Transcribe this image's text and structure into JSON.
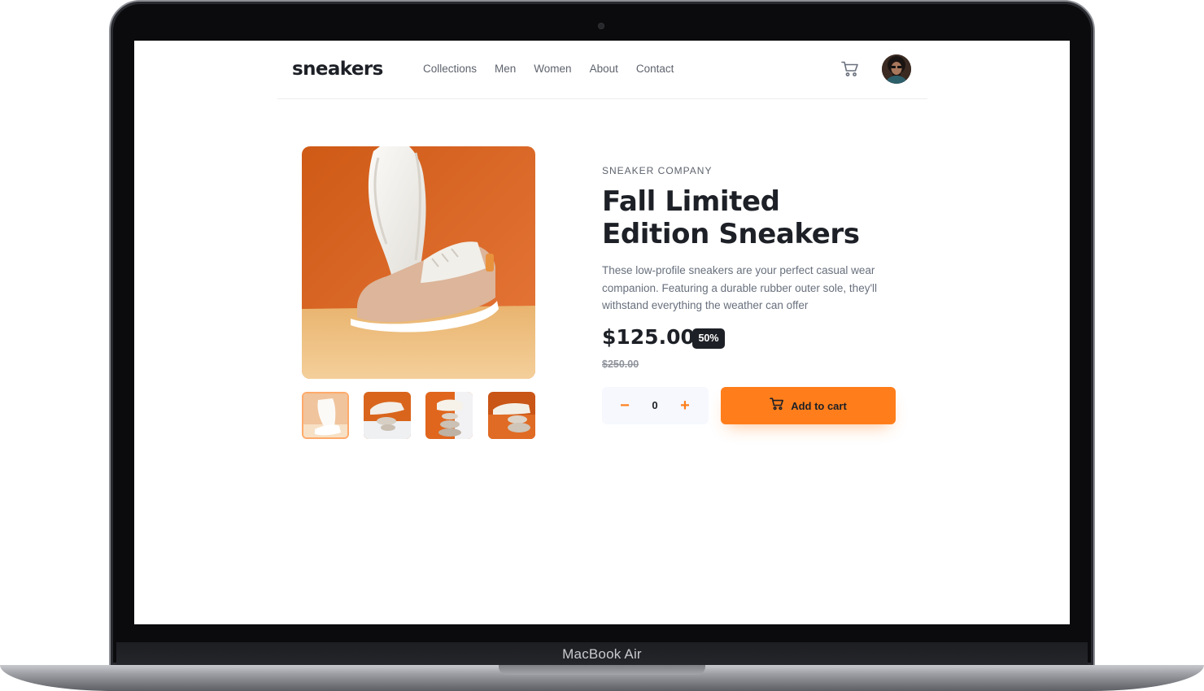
{
  "device": {
    "model_label": "MacBook Air"
  },
  "header": {
    "logo": "sneakers",
    "nav": [
      {
        "label": "Collections"
      },
      {
        "label": "Men"
      },
      {
        "label": "Women"
      },
      {
        "label": "About"
      },
      {
        "label": "Contact"
      }
    ],
    "cart_icon": "cart-icon",
    "avatar": "user-avatar"
  },
  "gallery": {
    "main_image": "sneaker-main-photo",
    "thumbnails": [
      {
        "name": "thumbnail-1",
        "active": true
      },
      {
        "name": "thumbnail-2",
        "active": false
      },
      {
        "name": "thumbnail-3",
        "active": false
      },
      {
        "name": "thumbnail-4",
        "active": false
      }
    ]
  },
  "product": {
    "company": "SNEAKER COMPANY",
    "title": "Fall Limited Edition Sneakers",
    "description": "These low-profile sneakers are your perfect casual wear companion. Featuring a durable rubber outer sole, they'll withstand everything the weather can offer",
    "price": "$125.00",
    "discount": "50%",
    "original_price": "$250.00"
  },
  "purchase": {
    "quantity": "0",
    "minus_label": "−",
    "plus_label": "+",
    "add_to_cart_label": "Add to cart"
  },
  "colors": {
    "accent": "#ff7e1b",
    "dark": "#1d2026",
    "muted": "#68707d",
    "light_bg": "#f6f8fd"
  }
}
